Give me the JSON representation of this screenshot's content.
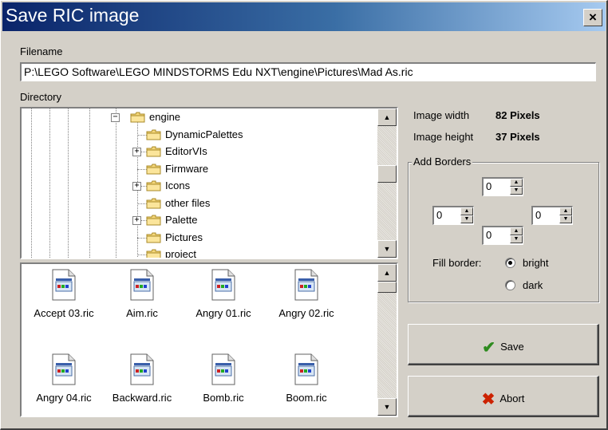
{
  "window": {
    "title": "Save RIC image",
    "close_glyph": "×"
  },
  "filename": {
    "label": "Filename",
    "value": "P:\\LEGO Software\\LEGO MINDSTORMS Edu NXT\\engine\\Pictures\\Mad As.ric"
  },
  "directory": {
    "label": "Directory",
    "tree": [
      {
        "label": "engine",
        "expander": "−"
      },
      {
        "label": "DynamicPalettes",
        "expander": ""
      },
      {
        "label": "EditorVIs",
        "expander": "+"
      },
      {
        "label": "Firmware",
        "expander": ""
      },
      {
        "label": "Icons",
        "expander": "+"
      },
      {
        "label": "other files",
        "expander": ""
      },
      {
        "label": "Palette",
        "expander": "+"
      },
      {
        "label": "Pictures",
        "expander": ""
      },
      {
        "label": "project",
        "expander": ""
      }
    ]
  },
  "files": [
    {
      "name": "Accept 03.ric"
    },
    {
      "name": "Aim.ric"
    },
    {
      "name": "Angry 01.ric"
    },
    {
      "name": "Angry 02.ric"
    },
    {
      "name": "Angry 04.ric"
    },
    {
      "name": "Backward.ric"
    },
    {
      "name": "Bomb.ric"
    },
    {
      "name": "Boom.ric"
    }
  ],
  "image_info": {
    "width_label": "Image width",
    "width_value": "82 Pixels",
    "height_label": "Image height",
    "height_value": "37 Pixels"
  },
  "borders": {
    "title": "Add Borders",
    "top": "0",
    "left": "0",
    "right": "0",
    "bottom": "0",
    "fill_label": "Fill border:",
    "options": [
      {
        "label": "bright",
        "selected": true
      },
      {
        "label": "dark",
        "selected": false
      }
    ]
  },
  "buttons": {
    "save": {
      "label": "Save",
      "icon": "checkmark-icon",
      "color": "#2e8b1f"
    },
    "abort": {
      "label": "Abort",
      "icon": "x-mark-icon",
      "color": "#cc2200"
    }
  },
  "colors": {
    "title_bar": "#0a246a",
    "dialog_bg": "#d4d0c8"
  }
}
